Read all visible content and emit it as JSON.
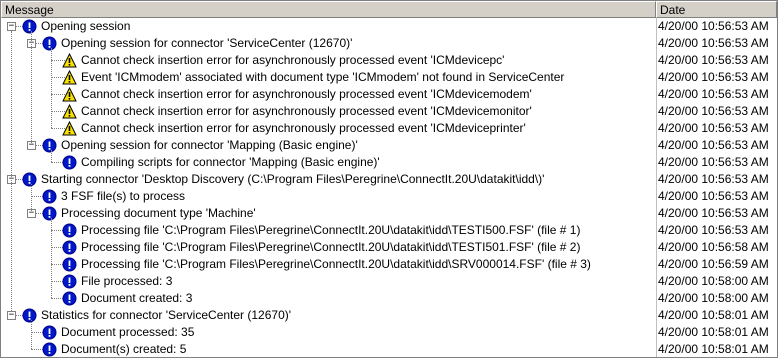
{
  "columns": {
    "message": "Message",
    "date": "Date"
  },
  "colors": {
    "info": "#0018c8",
    "warning": "#f8e000"
  },
  "rows": [
    {
      "depth": 0,
      "exp": "-",
      "icon": "info",
      "text": "Opening session",
      "date": "4/20/00 10:56:53 AM"
    },
    {
      "depth": 1,
      "exp": "-",
      "icon": "info",
      "text": "Opening session for connector 'ServiceCenter (12670)'",
      "date": "4/20/00 10:56:53 AM"
    },
    {
      "depth": 2,
      "exp": "",
      "icon": "warning",
      "text": "Cannot check insertion error for asynchronously processed event 'ICMdevicepc'",
      "date": "4/20/00 10:56:53 AM"
    },
    {
      "depth": 2,
      "exp": "",
      "icon": "warning",
      "text": "Event 'ICMmodem' associated with document type 'ICMmodem' not found in ServiceCenter",
      "date": "4/20/00 10:56:53 AM"
    },
    {
      "depth": 2,
      "exp": "",
      "icon": "warning",
      "text": "Cannot check insertion error for asynchronously processed event 'ICMdevicemodem'",
      "date": "4/20/00 10:56:53 AM"
    },
    {
      "depth": 2,
      "exp": "",
      "icon": "warning",
      "text": "Cannot check insertion error for asynchronously processed event 'ICMdevicemonitor'",
      "date": "4/20/00 10:56:53 AM"
    },
    {
      "depth": 2,
      "exp": "",
      "icon": "warning",
      "text": "Cannot check insertion error for asynchronously processed event 'ICMdeviceprinter'",
      "date": "4/20/00 10:56:53 AM"
    },
    {
      "depth": 1,
      "exp": "-",
      "icon": "info",
      "text": "Opening session for connector 'Mapping (Basic engine)'",
      "date": "4/20/00 10:56:53 AM"
    },
    {
      "depth": 2,
      "exp": "",
      "icon": "info",
      "text": "Compiling scripts for connector 'Mapping (Basic engine)'",
      "date": "4/20/00 10:56:53 AM"
    },
    {
      "depth": 0,
      "exp": "-",
      "icon": "info",
      "text": "Starting connector 'Desktop Discovery (C:\\Program Files\\Peregrine\\ConnectIt.20U\\datakit\\idd\\)'",
      "date": "4/20/00 10:56:53 AM"
    },
    {
      "depth": 1,
      "exp": "",
      "icon": "info",
      "text": "3 FSF file(s) to process",
      "date": "4/20/00 10:56:53 AM"
    },
    {
      "depth": 1,
      "exp": "-",
      "icon": "info",
      "text": "Processing document type 'Machine'",
      "date": "4/20/00 10:56:53 AM"
    },
    {
      "depth": 2,
      "exp": "",
      "icon": "info",
      "text": "Processing file 'C:\\Program Files\\Peregrine\\ConnectIt.20U\\datakit\\idd\\TESTI500.FSF' (file # 1)",
      "date": "4/20/00 10:56:53 AM"
    },
    {
      "depth": 2,
      "exp": "",
      "icon": "info",
      "text": "Processing file 'C:\\Program Files\\Peregrine\\ConnectIt.20U\\datakit\\idd\\TESTI501.FSF' (file # 2)",
      "date": "4/20/00 10:56:58 AM"
    },
    {
      "depth": 2,
      "exp": "",
      "icon": "info",
      "text": "Processing file 'C:\\Program Files\\Peregrine\\ConnectIt.20U\\datakit\\idd\\SRV000014.FSF' (file # 3)",
      "date": "4/20/00 10:56:59 AM"
    },
    {
      "depth": 2,
      "exp": "",
      "icon": "info",
      "text": "File processed: 3",
      "date": "4/20/00 10:58:00 AM"
    },
    {
      "depth": 2,
      "exp": "",
      "icon": "info",
      "text": "Document created: 3",
      "date": "4/20/00 10:58:00 AM"
    },
    {
      "depth": 0,
      "exp": "-",
      "icon": "info",
      "text": "Statistics for connector 'ServiceCenter (12670)'",
      "date": "4/20/00 10:58:01 AM"
    },
    {
      "depth": 1,
      "exp": "",
      "icon": "info",
      "text": "Document processed: 35",
      "date": "4/20/00 10:58:01 AM"
    },
    {
      "depth": 1,
      "exp": "",
      "icon": "info",
      "text": "Document(s) created: 5",
      "date": "4/20/00 10:58:01 AM"
    }
  ]
}
